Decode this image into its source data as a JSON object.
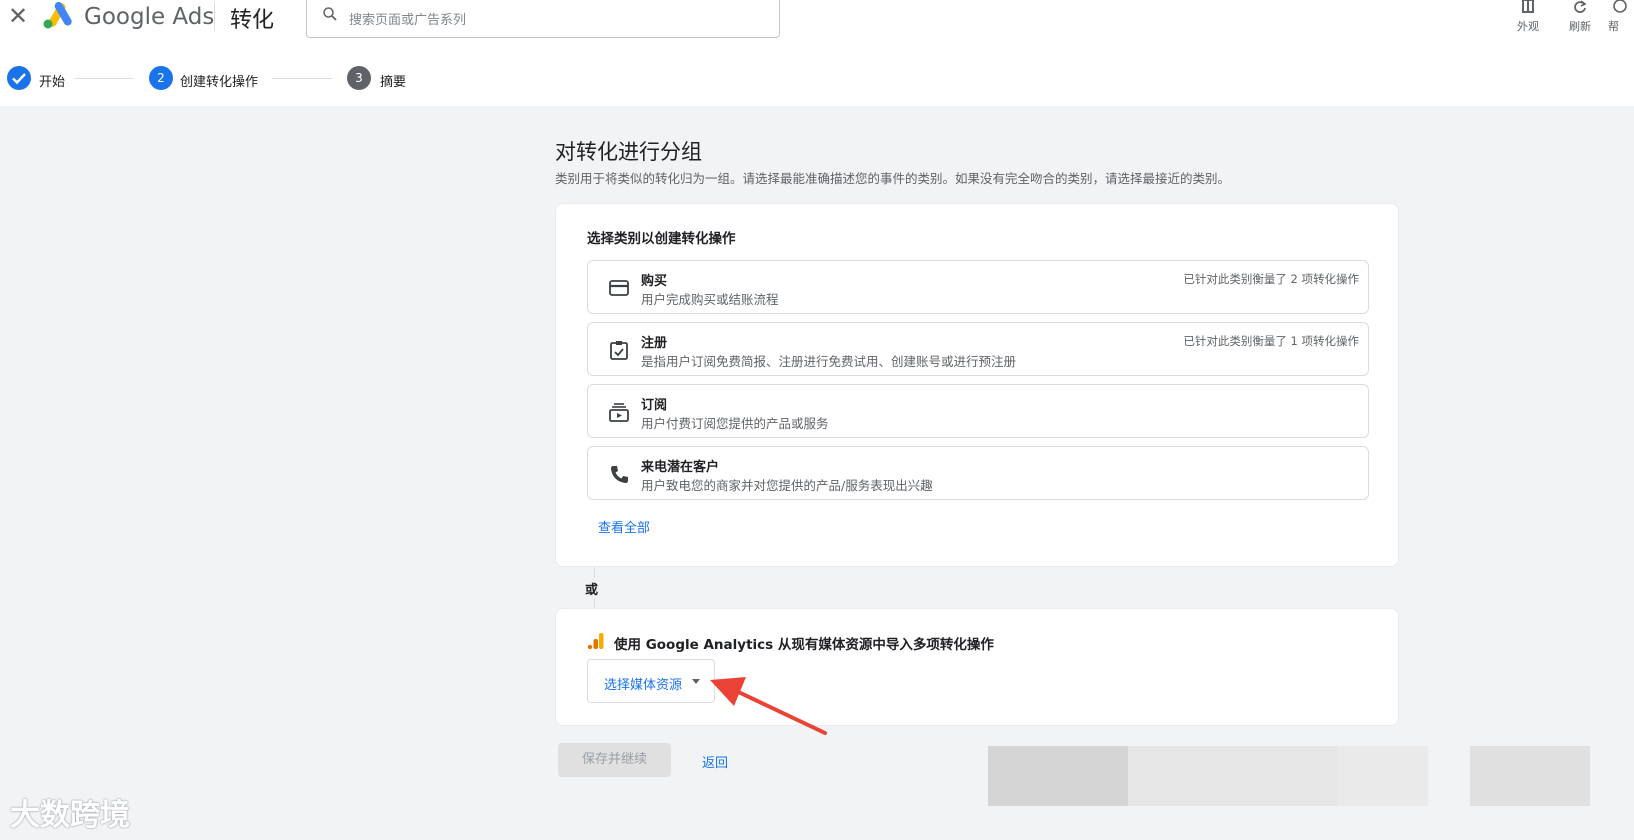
{
  "topbar": {
    "brand": "Google Ads",
    "page_name": "转化",
    "search_placeholder": "搜索页面或广告系列",
    "tools": [
      "外观",
      "刷新",
      "帮"
    ]
  },
  "stepper": {
    "steps": [
      {
        "label": "开始",
        "state": "done"
      },
      {
        "label": "创建转化操作",
        "state": "current",
        "number": "2"
      },
      {
        "label": "摘要",
        "state": "upcoming",
        "number": "3"
      }
    ]
  },
  "main": {
    "title": "对转化进行分组",
    "subtitle": "类别用于将类似的转化归为一组。请选择最能准确描述您的事件的类别。如果没有完全吻合的类别，请选择最接近的类别。",
    "category_card": {
      "heading": "选择类别以创建转化操作",
      "options": [
        {
          "icon": "credit-card-icon",
          "title": "购买",
          "desc": "用户完成购买或结账流程",
          "meta": "已针对此类别衡量了 2 项转化操作"
        },
        {
          "icon": "checklist-icon",
          "title": "注册",
          "desc": "是指用户订阅免费简报、注册进行免费试用、创建账号或进行预注册",
          "meta": "已针对此类别衡量了 1 项转化操作"
        },
        {
          "icon": "subscription-icon",
          "title": "订阅",
          "desc": "用户付费订阅您提供的产品或服务",
          "meta": ""
        },
        {
          "icon": "phone-icon",
          "title": "来电潜在客户",
          "desc": "用户致电您的商家并对您提供的产品/服务表现出兴趣",
          "meta": ""
        }
      ],
      "view_all": "查看全部"
    },
    "or_label": "或",
    "analytics_card": {
      "text": "使用 Google Analytics 从现有媒体资源中导入多项转化操作",
      "select_label": "选择媒体资源"
    },
    "save_button": "保存并继续",
    "back_link": "返回"
  },
  "watermark": "大数跨境",
  "colors": {
    "accent": "#1a73e8",
    "step_done": "#1a73e8",
    "step_upcoming": "#5f6368",
    "arrow": "#ea4335",
    "analytics_orange": "#f9ab00",
    "analytics_dark_orange": "#e37400"
  }
}
